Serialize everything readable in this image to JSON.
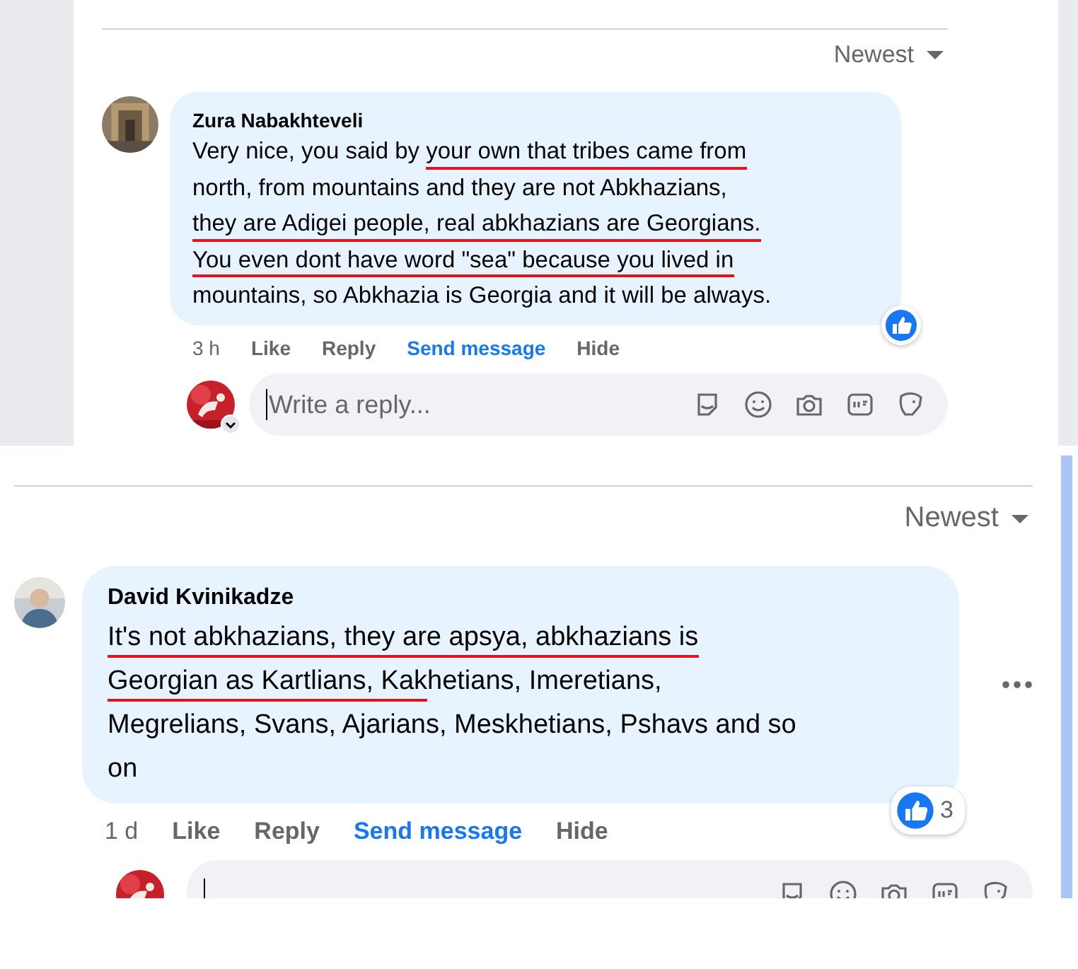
{
  "panels": [
    {
      "sort_label": "Newest",
      "more_button": false,
      "comment": {
        "author": "Zura Nabakhteveli",
        "lines": [
          [
            {
              "text": "Very nice, you said by ",
              "underlined": false
            },
            {
              "text": "your own that tribes came from",
              "underlined": true
            }
          ],
          [
            {
              "text": "north, from mountains and they are not Abkhazians,",
              "underlined": false
            }
          ],
          [
            {
              "text": "they are Adigei people, real abkhazians are Georgians.",
              "underlined": true
            }
          ],
          [
            {
              "text": "You even dont have word \"sea\" because you lived in",
              "underlined": true
            }
          ],
          [
            {
              "text": "mountains, so Abkhazia is Georgia and it will be always.",
              "underlined": false
            }
          ]
        ],
        "time": "3 h",
        "actions": [
          {
            "label": "Like",
            "kind": "plain"
          },
          {
            "label": "Reply",
            "kind": "plain"
          },
          {
            "label": "Send message",
            "kind": "link"
          },
          {
            "label": "Hide",
            "kind": "plain"
          }
        ],
        "reactions": {
          "kind": "like"
        }
      },
      "reply_field": {
        "placeholder": "Write a reply..."
      }
    },
    {
      "sort_label": "Newest",
      "more_button": true,
      "comment": {
        "author": "David Kvinikadze",
        "lines": [
          [
            {
              "text": "It's not abkhazians, they are apsya, abkhazians is",
              "underlined": true
            }
          ],
          [
            {
              "text": "Georgian as Kartlians, Kak",
              "underlined": true
            },
            {
              "text": "hetians, Imeretians,",
              "underlined": false
            }
          ],
          [
            {
              "text": "Megrelians, Svans, Ajarians, Meskhetians, Pshavs and so",
              "underlined": false
            }
          ],
          [
            {
              "text": "on",
              "underlined": false
            }
          ]
        ],
        "time": "1 d",
        "actions": [
          {
            "label": "Like",
            "kind": "plain"
          },
          {
            "label": "Reply",
            "kind": "plain"
          },
          {
            "label": "Send message",
            "kind": "link"
          },
          {
            "label": "Hide",
            "kind": "plain"
          }
        ],
        "reactions": {
          "kind": "like",
          "count": "3"
        }
      }
    }
  ]
}
